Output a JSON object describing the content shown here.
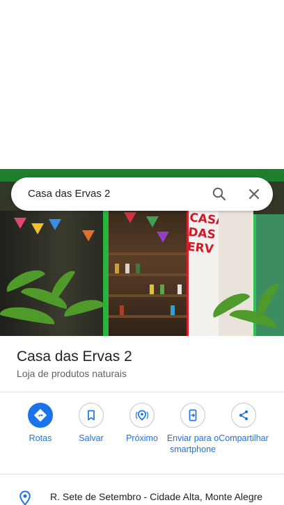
{
  "search": {
    "query": "Casa das Ervas 2"
  },
  "place": {
    "name": "Casa das Ervas 2",
    "category": "Loja de produtos naturais",
    "sign_text": "CASA DAS ERV"
  },
  "actions": [
    {
      "label": "Rotas",
      "icon": "directions-icon"
    },
    {
      "label": "Salvar",
      "icon": "bookmark-icon"
    },
    {
      "label": "Próximo",
      "icon": "nearby-icon"
    },
    {
      "label": "Enviar para o smartphone",
      "icon": "send-to-phone-icon"
    },
    {
      "label": "Compartilhar",
      "icon": "share-icon"
    }
  ],
  "address": {
    "text": "R. Sete de Setembro - Cidade Alta, Monte Alegre"
  },
  "colors": {
    "accent": "#1a73e8",
    "text_primary": "#202124",
    "text_secondary": "#5f6368"
  }
}
